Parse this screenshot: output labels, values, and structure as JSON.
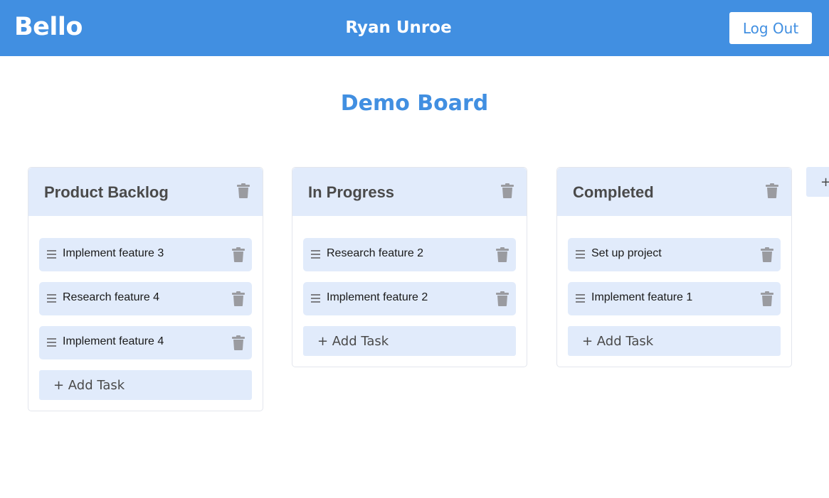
{
  "header": {
    "brand": "Bello",
    "user": "Ryan Unroe",
    "logout_label": "Log Out"
  },
  "board": {
    "title": "Demo Board",
    "add_column_label": "+",
    "columns": [
      {
        "title": "Product Backlog",
        "tasks": [
          "Implement feature 3",
          "Research feature 4",
          "Implement feature 4"
        ],
        "add_label": "+ Add Task"
      },
      {
        "title": "In Progress",
        "tasks": [
          "Research feature 2",
          "Implement feature 2"
        ],
        "add_label": "+ Add Task"
      },
      {
        "title": "Completed",
        "tasks": [
          "Set up project",
          "Implement feature 1"
        ],
        "add_label": "+ Add Task"
      }
    ]
  },
  "colors": {
    "accent": "#418fe1",
    "card_bg": "#e1ebfb",
    "icon_gray": "#9a9ba0"
  },
  "icons": {
    "column_delete": "trash-icon",
    "task_drag": "drag-handle-icon",
    "task_delete": "trash-icon"
  }
}
